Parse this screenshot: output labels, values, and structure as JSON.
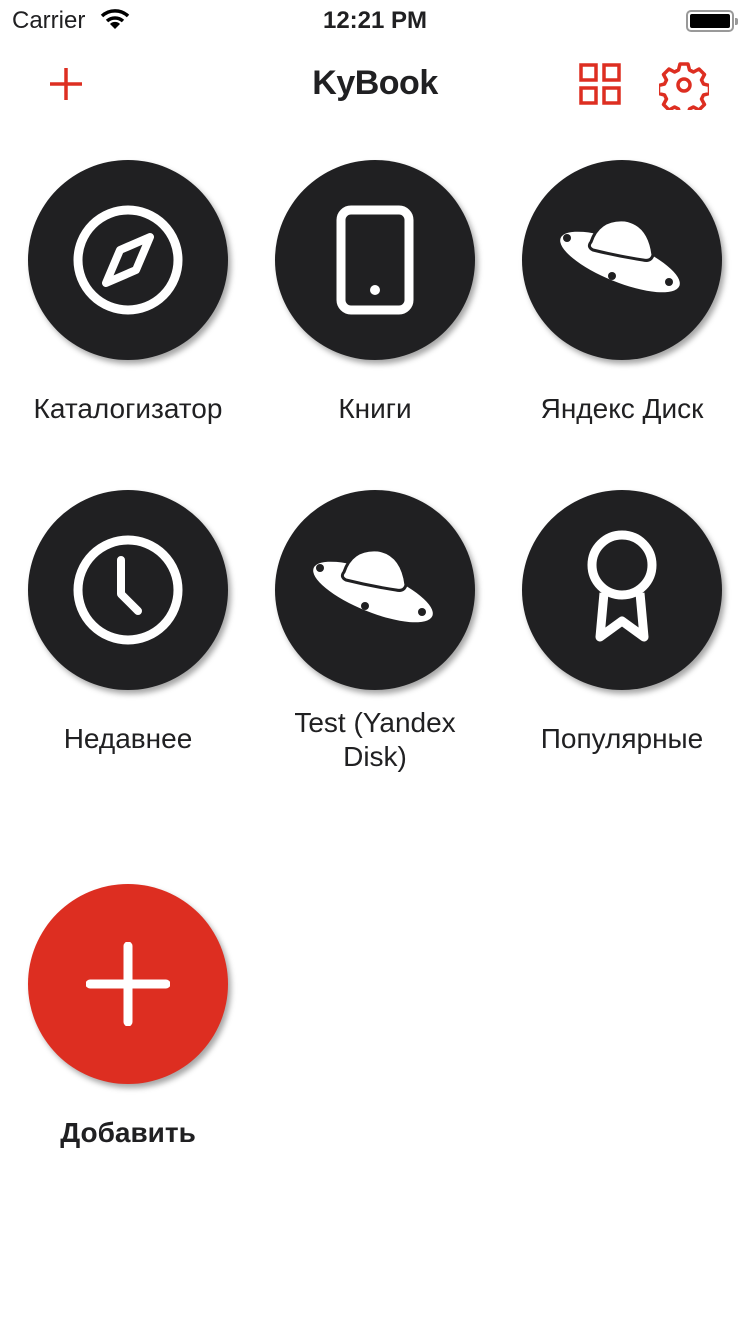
{
  "status_bar": {
    "carrier": "Carrier",
    "time": "12:21 PM",
    "wifi_icon": "wifi-icon",
    "battery_icon": "battery-icon"
  },
  "nav": {
    "title": "KyBook",
    "add_icon": "plus-icon",
    "grid_icon": "grid-icon",
    "settings_icon": "gear-icon",
    "accent": "#dd2e21"
  },
  "tiles": [
    {
      "label": "Каталогизатор",
      "icon": "compass-icon"
    },
    {
      "label": "Книги",
      "icon": "tablet-icon"
    },
    {
      "label": "Яндекс Диск",
      "icon": "ufo-icon"
    },
    {
      "label": "Недавнее",
      "icon": "clock-icon"
    },
    {
      "label": "Test (Yandex Disk)",
      "icon": "ufo-icon"
    },
    {
      "label": "Популярные",
      "icon": "award-icon"
    },
    {
      "label": "Добавить",
      "icon": "plus-icon"
    }
  ],
  "colors": {
    "tile": "#202022",
    "add_tile": "#dd2e21"
  }
}
